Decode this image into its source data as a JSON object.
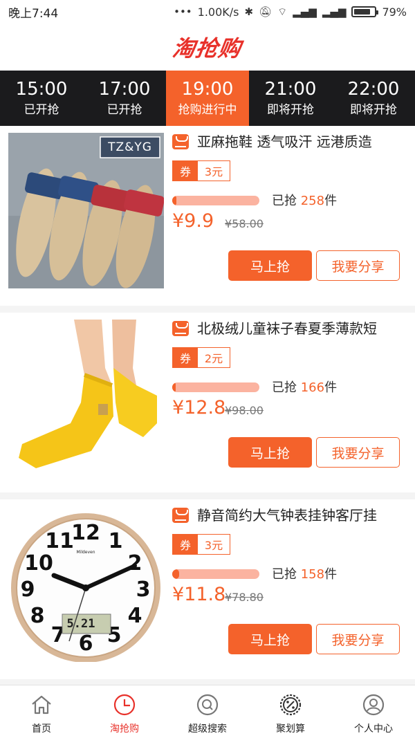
{
  "status_bar": {
    "time": "晚上7:44",
    "net_speed": "1.00K/s",
    "battery": "79%",
    "battery_level": 0.79
  },
  "header": {
    "logo_text": "淘抢购"
  },
  "time_tabs": [
    {
      "time": "15:00",
      "status": "已开抢"
    },
    {
      "time": "17:00",
      "status": "已开抢"
    },
    {
      "time": "19:00",
      "status": "抢购进行中"
    },
    {
      "time": "21:00",
      "status": "即将开抢"
    },
    {
      "time": "22:00",
      "status": "即将开抢"
    }
  ],
  "products": [
    {
      "title": "亚麻拖鞋 透气吸汗 远港质造",
      "brand_tag": "TZ&YG",
      "coupon_label": "券",
      "coupon_value": "3元",
      "sold_prefix": "已抢",
      "sold_count": "258",
      "sold_unit": "件",
      "progress": 0.05,
      "price": "¥9.9",
      "old_price": "¥58.00",
      "buy_label": "马上抢",
      "share_label": "我要分享"
    },
    {
      "title": "北极绒儿童袜子春夏季薄款短",
      "brand_tag": "",
      "coupon_label": "券",
      "coupon_value": "2元",
      "sold_prefix": "已抢",
      "sold_count": "166",
      "sold_unit": "件",
      "progress": 0.03,
      "price": "¥12.8",
      "old_price": "¥98.00",
      "buy_label": "马上抢",
      "share_label": "我要分享"
    },
    {
      "title": "静音简约大气钟表挂钟客厅挂",
      "brand_tag": "",
      "clock_brand": "Mildeven",
      "clock_lcd": "5.21",
      "coupon_label": "券",
      "coupon_value": "3元",
      "sold_prefix": "已抢",
      "sold_count": "158",
      "sold_unit": "件",
      "progress": 0.08,
      "price": "¥11.8",
      "old_price": "¥78.80",
      "buy_label": "马上抢",
      "share_label": "我要分享"
    }
  ],
  "bottom_nav": [
    {
      "label": "首页",
      "icon": "home-icon"
    },
    {
      "label": "淘抢购",
      "icon": "clock-icon"
    },
    {
      "label": "超级搜索",
      "icon": "search-icon"
    },
    {
      "label": "聚划算",
      "icon": "discount-icon"
    },
    {
      "label": "个人中心",
      "icon": "user-icon"
    }
  ],
  "colors": {
    "accent": "#f4622b",
    "logo": "#e8312a",
    "tab_bar": "#1b1b1d"
  }
}
